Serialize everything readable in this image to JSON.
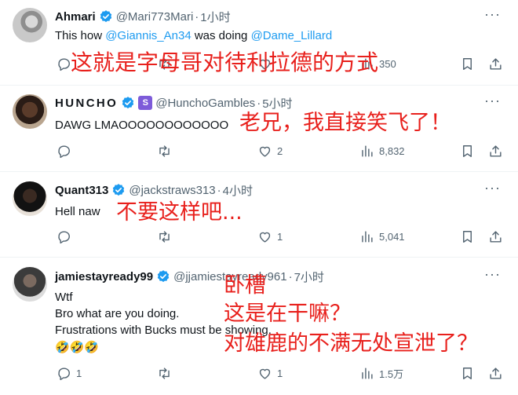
{
  "tweets": [
    {
      "name": "Ahmari",
      "handle": "@Mari773Mari",
      "dot": "·",
      "time": "1小时",
      "body": {
        "pre": "This how ",
        "mention1": "@Giannis_An34",
        "mid": " was doing ",
        "mention2": "@Dame_Lillard"
      },
      "views": "350",
      "overlay": "这就是字母哥对待利拉德的方式"
    },
    {
      "name": "HUNCHO",
      "badge": "S",
      "handle": "@HunchoGambles",
      "dot": "·",
      "time": "5小时",
      "body": "DAWG LMAOOOOOOOOOOOO",
      "likes": "2",
      "views": "8,832",
      "overlay": "老兄，我直接笑飞了！"
    },
    {
      "name": "Quant313",
      "handle": "@jackstraws313",
      "dot": "·",
      "time": "4小时",
      "body": "Hell naw",
      "likes": "1",
      "views": "5,041",
      "overlay": "不要这样吧..."
    },
    {
      "name": "jamiestayready99",
      "handle": "@jjamiestayready961",
      "dot": "·",
      "time": "7小时",
      "body_lines": [
        "Wtf",
        "Bro what are you doing.",
        "Frustrations with Bucks must be showing.",
        "🤣🤣🤣"
      ],
      "replies": "1",
      "likes": "1",
      "views": "1.5万",
      "overlay_lines": [
        "卧槽",
        "这是在干嘛？",
        "对雄鹿的不满无处宣泄了？"
      ]
    }
  ],
  "more_label": "···",
  "colors": {
    "link": "#1d9bf0",
    "verified": "#1d9bf0",
    "overlay": "#e8201c",
    "muted": "#536471"
  }
}
